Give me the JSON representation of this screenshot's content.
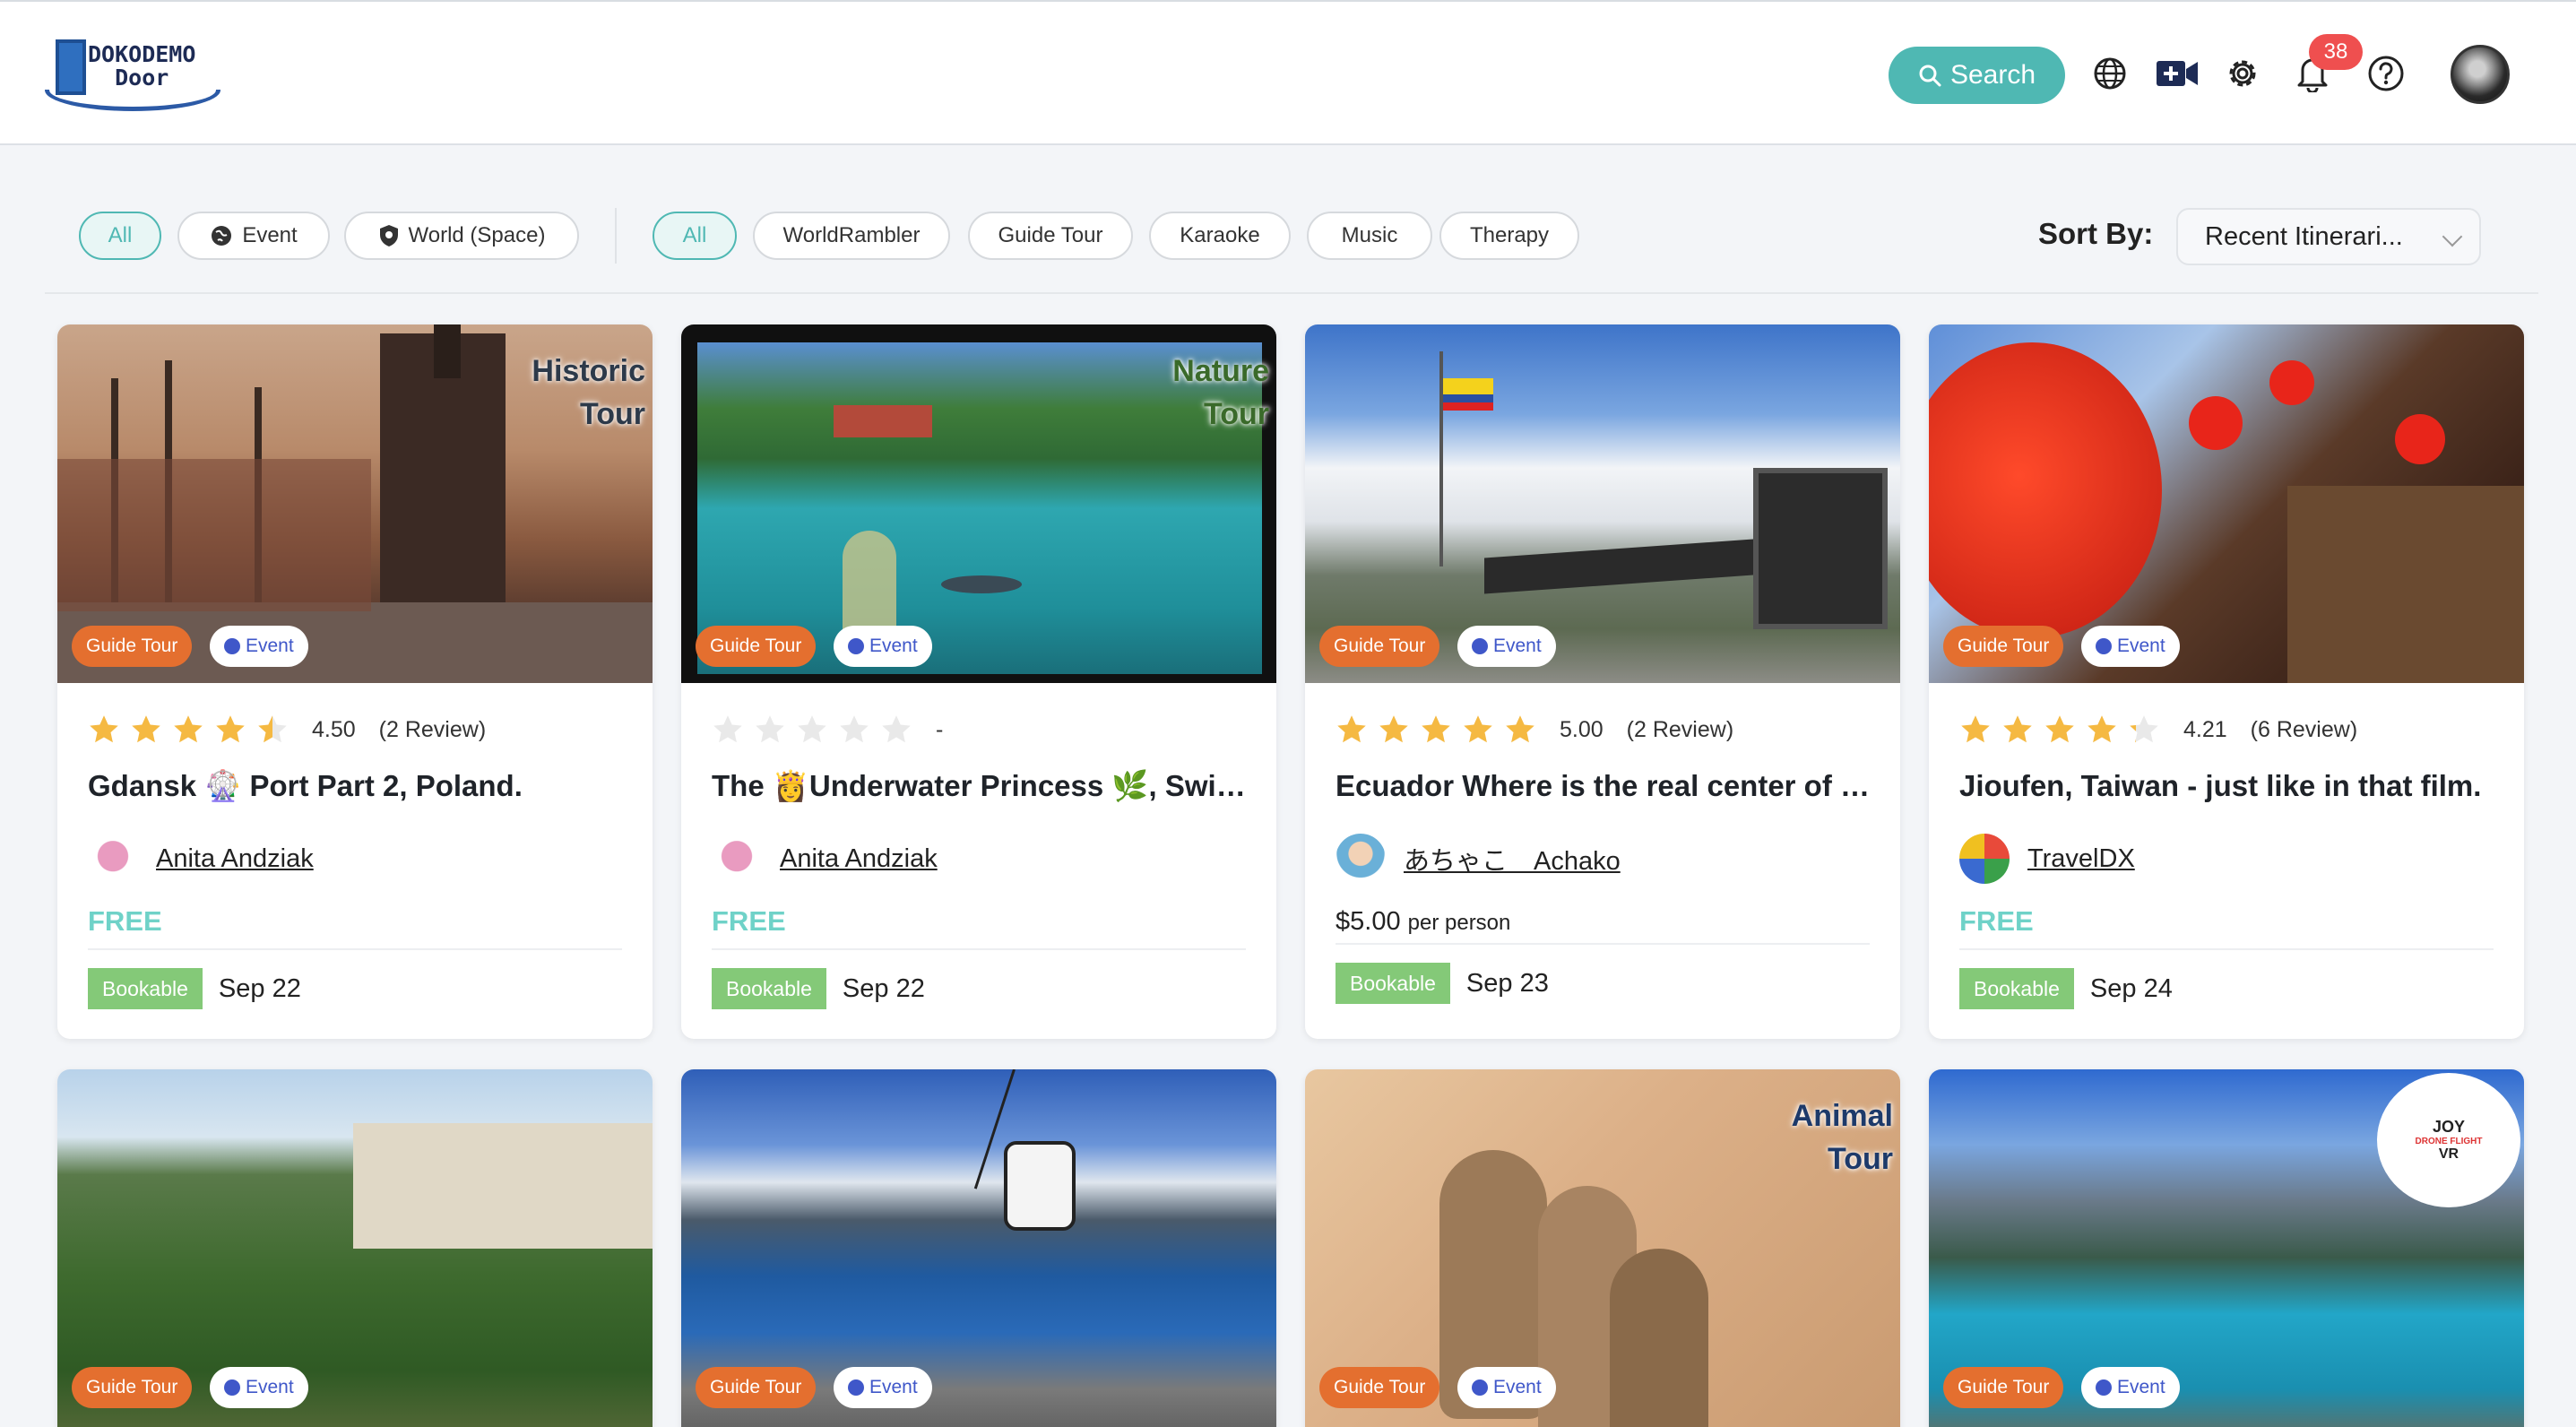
{
  "header": {
    "logo_text": [
      "DOKODEMO",
      "Door"
    ],
    "search_label": "Search",
    "notification_count": "38",
    "icons": [
      "globe-icon",
      "video-add-icon",
      "gear-icon",
      "bell-icon",
      "help-icon"
    ]
  },
  "filters": {
    "type_chips": [
      {
        "label": "All",
        "active": true
      },
      {
        "label": "Event",
        "icon": "globe-icon"
      },
      {
        "label": "World (Space)",
        "icon": "shield-icon"
      }
    ],
    "category_chips": [
      {
        "label": "All",
        "active": true
      },
      {
        "label": "WorldRambler"
      },
      {
        "label": "Guide Tour"
      },
      {
        "label": "Karaoke"
      },
      {
        "label": "Music"
      },
      {
        "label": "Therapy"
      }
    ],
    "sort_label": "Sort By:",
    "sort_value": "Recent Itinerari..."
  },
  "cards": [
    {
      "overlay": [
        "Historic",
        "Tour"
      ],
      "tags": [
        "Guide Tour",
        "Event"
      ],
      "rating_value": 4.5,
      "rating": "4.50",
      "reviews": "(2 Review)",
      "title": "Gdansk 🎡 Port Part 2, Poland.",
      "host": "Anita Andziak",
      "price": "FREE",
      "status": "Bookable",
      "date": "Sep 22"
    },
    {
      "overlay": [
        "Nature",
        "Tour"
      ],
      "tags": [
        "Guide Tour",
        "Event"
      ],
      "rating_value": 0,
      "rating": "-",
      "reviews": "",
      "title": "The 👸Underwater Princess 🌿, Switz...",
      "host": "Anita Andziak",
      "price": "FREE",
      "status": "Bookable",
      "date": "Sep 22"
    },
    {
      "overlay": [],
      "tags": [
        "Guide Tour",
        "Event"
      ],
      "rating_value": 5,
      "rating": "5.00",
      "reviews": "(2 Review)",
      "title": "Ecuador Where is the real center of t...",
      "host": "あちゃこ　Achako",
      "price": "$5.00",
      "price_unit": "per person",
      "status": "Bookable",
      "date": "Sep 23"
    },
    {
      "overlay": [],
      "tags": [
        "Guide Tour",
        "Event"
      ],
      "rating_value": 4.21,
      "rating": "4.21",
      "reviews": "(6 Review)",
      "title": "Jioufen, Taiwan - just like in that film.",
      "host": "TravelDX",
      "price": "FREE",
      "status": "Bookable",
      "date": "Sep 24"
    },
    {
      "overlay": [],
      "tags": [
        "Guide Tour",
        "Event"
      ]
    },
    {
      "overlay": [],
      "tags": [
        "Guide Tour",
        "Event"
      ]
    },
    {
      "overlay": [
        "Animal",
        "Tour"
      ],
      "tags": [
        "Guide Tour",
        "Event"
      ]
    },
    {
      "overlay": [],
      "badge_text": [
        "JOY",
        "DRONE FLIGHT",
        "VR"
      ],
      "tags": [
        "Guide Tour",
        "Event"
      ]
    }
  ]
}
